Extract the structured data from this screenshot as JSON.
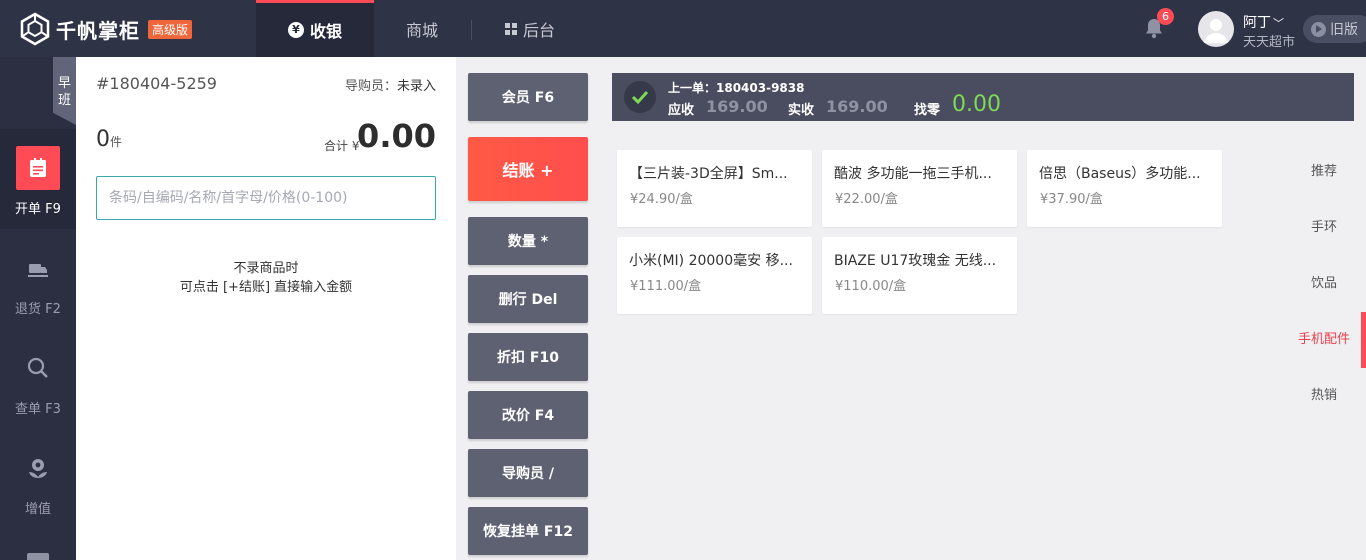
{
  "header": {
    "logo_text": "千帆掌柜",
    "edition": "高级版",
    "tabs": [
      {
        "label": "收银",
        "icon": "coin-icon"
      },
      {
        "label": "商城"
      },
      {
        "label": "后台",
        "icon": "grid-icon"
      }
    ],
    "notification_count": "6",
    "user_name": "阿丁",
    "store_name": "天天超市",
    "old_version": "旧版",
    "accent_color": "#ff4b55"
  },
  "sidebar": {
    "shift": "早班",
    "items": [
      {
        "label": "开单 F9",
        "icon": "order-icon"
      },
      {
        "label": "退货 F2",
        "icon": "return-truck-icon"
      },
      {
        "label": "查单 F3",
        "icon": "search-icon"
      },
      {
        "label": "增值",
        "icon": "flower-icon"
      }
    ]
  },
  "order": {
    "number": "#180404-5259",
    "guide_label": "导购员：",
    "guide_value": "未录入",
    "count": "0",
    "count_unit": "件",
    "total_label": "合计 ¥",
    "total": "0.00",
    "search_placeholder": "条码/自编码/名称/首字母/价格(0-100)",
    "hint_line1": "不录商品时",
    "hint_line2": "可点击 [+结账] 直接输入金额"
  },
  "actions": {
    "member": "会员 F6",
    "checkout": "结账 +",
    "quantity": "数量 *",
    "delete_row": "删行 Del",
    "discount": "折扣 F10",
    "change_price": "改价 F4",
    "salesperson": "导购员 /",
    "restore": "恢复挂单 F12"
  },
  "last_order": {
    "title": "上一单：180403-9838",
    "receivable_label": "应收",
    "receivable": "169.00",
    "received_label": "实收",
    "received": "169.00",
    "change_label": "找零",
    "change": "0.00"
  },
  "products": [
    {
      "name": "【三片装-3D全屏】Sm...",
      "price": "¥24.90/盒"
    },
    {
      "name": "酷波 多功能一拖三手机...",
      "price": "¥22.00/盒"
    },
    {
      "name": "倍思（Baseus）多功能...",
      "price": "¥37.90/盒"
    },
    {
      "name": "小米(MI) 20000毫安 移...",
      "price": "¥111.00/盒"
    },
    {
      "name": "BIAZE U17玫瑰金 无线...",
      "price": "¥110.00/盒"
    }
  ],
  "categories": [
    {
      "label": "推荐"
    },
    {
      "label": "手环"
    },
    {
      "label": "饮品"
    },
    {
      "label": "手机配件"
    },
    {
      "label": "热销"
    }
  ]
}
